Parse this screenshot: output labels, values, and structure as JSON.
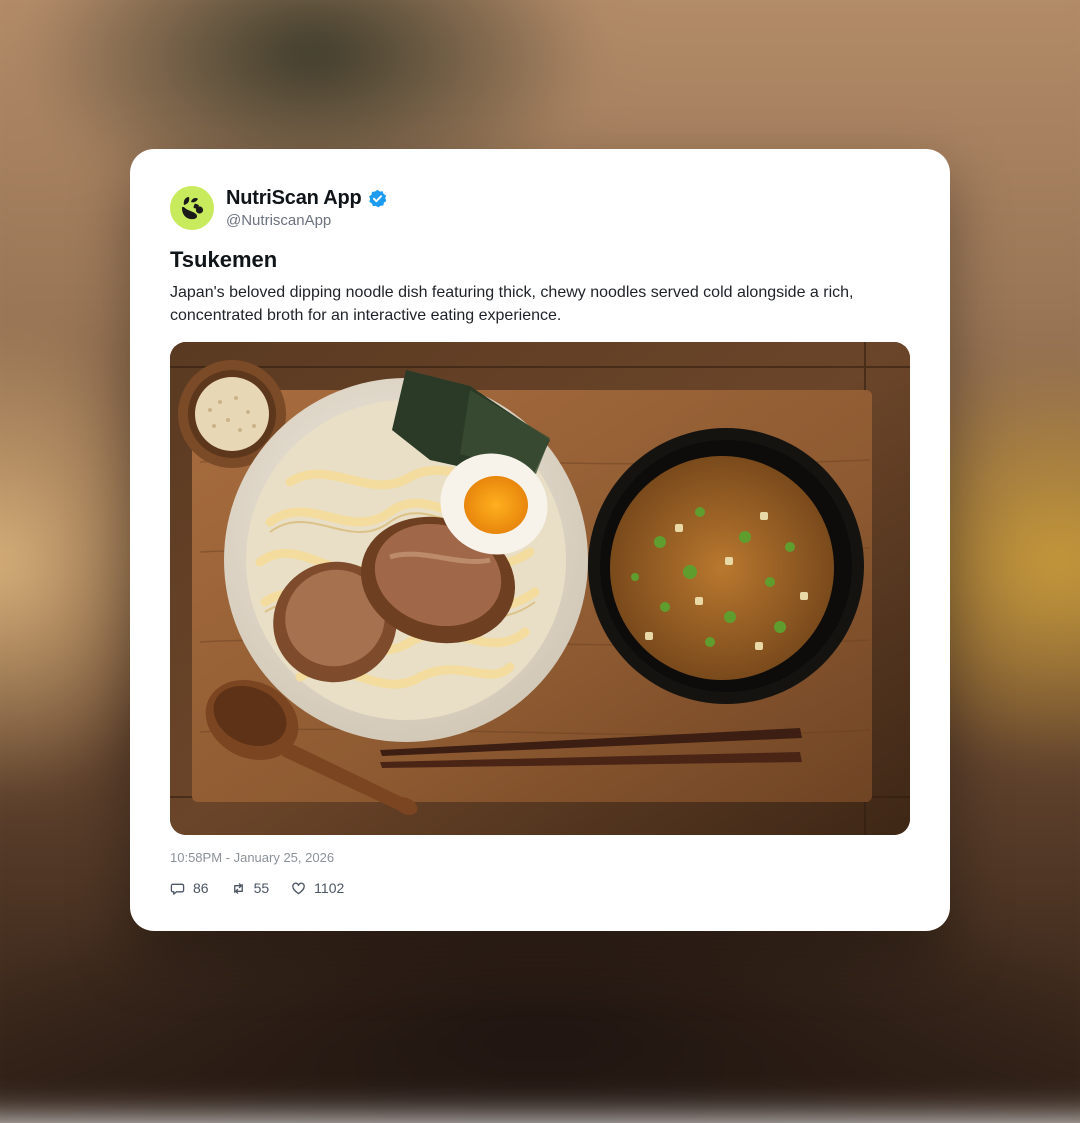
{
  "post": {
    "author": {
      "display_name": "NutriScan App",
      "handle": "@NutriscanApp",
      "verified": true,
      "avatar_icon": "leaf-logo-icon",
      "avatar_color": "#c8eb5e"
    },
    "title": "Tsukemen",
    "description": "Japan's beloved dipping noodle dish featuring thick, chewy noodles served cold alongside a rich, concentrated broth for an interactive eating experience.",
    "image_alt": "Tsukemen with noodles, chashu pork, soft-boiled egg and nori beside a bowl of dipping broth",
    "timestamp": "10:58PM - January 25, 2026",
    "stats": {
      "replies": "86",
      "reposts": "55",
      "likes": "1102"
    },
    "icons": {
      "replies": "comment-icon",
      "reposts": "repost-icon",
      "likes": "heart-icon"
    },
    "colors": {
      "verified_badge": "#1d9bf0",
      "text_primary": "#0f1419",
      "text_secondary": "#6b7280"
    }
  }
}
